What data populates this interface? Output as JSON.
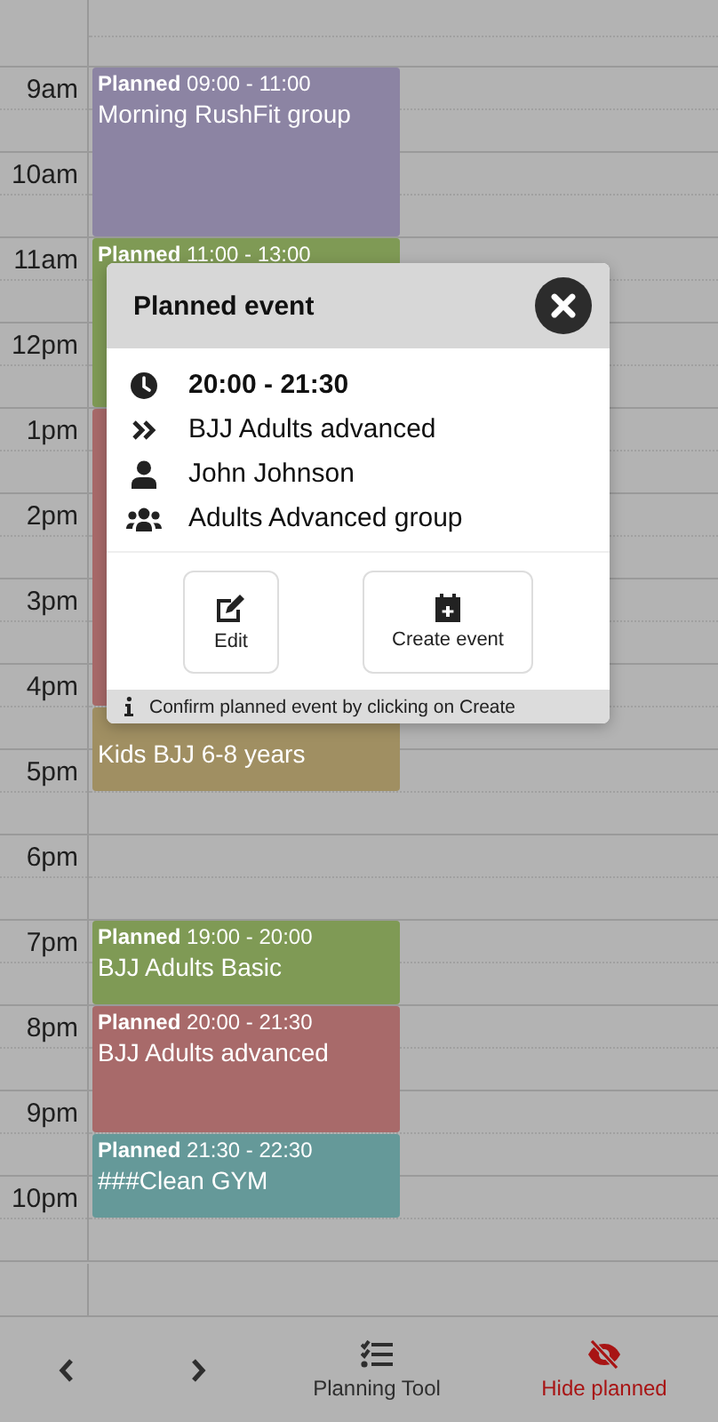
{
  "calendar": {
    "hours": [
      "9am",
      "10am",
      "11am",
      "12pm",
      "1pm",
      "2pm",
      "3pm",
      "4pm",
      "5pm",
      "6pm",
      "7pm",
      "8pm",
      "9pm",
      "10pm"
    ],
    "events": [
      {
        "header": "**Planned** 09:00 - 11:00",
        "title": "Morning RushFit group",
        "color": "#8c84a3"
      },
      {
        "header": "**Planned** 11:00 - 13:00",
        "color": "#7f9a55"
      },
      {
        "color": "#a86a6a"
      },
      {
        "title": "Kids BJJ 6-8 years",
        "color": "#a08f62"
      },
      {
        "header": "**Planned** 19:00 - 20:00",
        "title": "BJJ Adults Basic",
        "color": "#7f9a55"
      },
      {
        "header": "**Planned** 20:00 - 21:30",
        "title": "BJJ Adults advanced",
        "color": "#a86a6a"
      },
      {
        "header": "**Planned** 21:30 - 22:30",
        "title": "###Clean GYM",
        "color": "#659999"
      }
    ]
  },
  "dialog": {
    "title": "Planned event",
    "details": [
      {
        "kind": "time",
        "text": "20:00 - 21:30"
      },
      {
        "kind": "activity",
        "text": "BJJ Adults advanced"
      },
      {
        "kind": "person",
        "text": "John Johnson"
      },
      {
        "kind": "group",
        "text": "Adults Advanced group"
      }
    ],
    "actions": [
      {
        "kind": "edit",
        "label": "Edit"
      },
      {
        "kind": "create",
        "label": "Create event"
      }
    ],
    "hint": "Confirm planned event by clicking on Create"
  },
  "bottom_bar": {
    "items": [
      {
        "kind": "prev",
        "on": false
      },
      {
        "kind": "next",
        "on": false
      },
      {
        "kind": "planning",
        "label": "Planning Tool",
        "on": false
      },
      {
        "kind": "hide",
        "label": "Hide planned",
        "on": true
      }
    ]
  }
}
